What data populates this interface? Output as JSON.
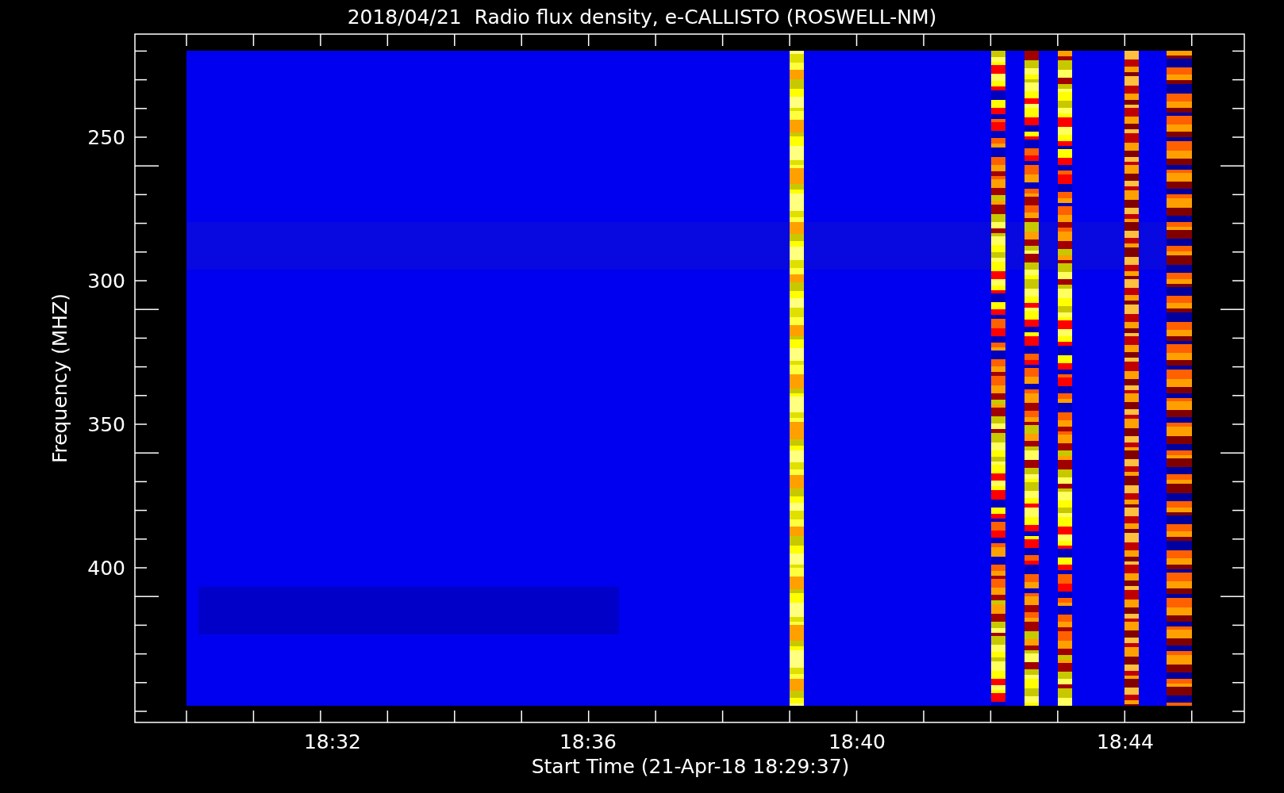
{
  "plot": {
    "title": "2018/04/21  Radio flux density, e-CALLISTO (ROSWELL-NM)",
    "ylabel": "Frequency (MHZ)",
    "yticks": [
      "250",
      "300",
      "350",
      "400"
    ],
    "xticks": [
      "18:32",
      "18:36",
      "18:40",
      "18:44"
    ],
    "xlabel": "Start Time (21-Apr-18 18:29:37)"
  }
}
